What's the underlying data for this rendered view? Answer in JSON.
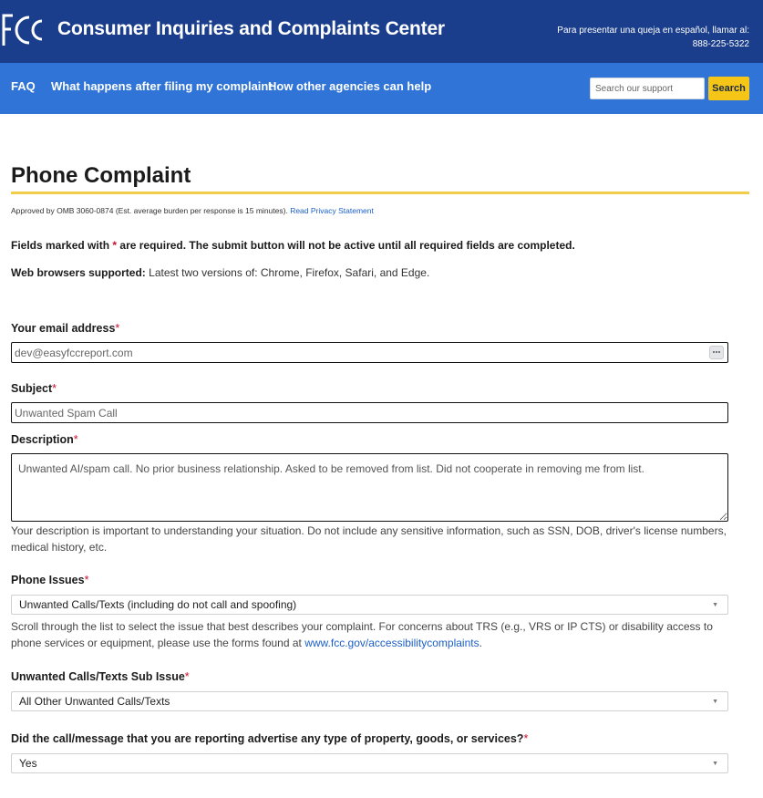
{
  "header": {
    "logo_text": "FCC",
    "title": "Consumer Inquiries and Complaints Center",
    "spanish_line1": "Para presentar una queja en español, llamar al:",
    "spanish_phone": "888-225-5322"
  },
  "nav": {
    "items": [
      {
        "label": "FAQ"
      },
      {
        "label": "What happens after filing my complaint"
      },
      {
        "label": "How other agencies can help"
      }
    ],
    "search_placeholder": "Search our support",
    "search_button": "Search"
  },
  "page": {
    "title": "Phone Complaint",
    "omb_text": "Approved by OMB 3060-0874 (Est. average burden per response is 15 minutes).",
    "privacy_link": "Read Privacy Statement",
    "required_note_before": "Fields marked with",
    "required_star": "*",
    "required_note_after": "are required. The submit button will not be active until all required fields are completed.",
    "browsers_label": "Web browsers supported:",
    "browsers_text": "Latest two versions of: Chrome, Firefox, Safari, and Edge."
  },
  "form": {
    "email": {
      "label": "Your email address",
      "placeholder": "dev@easyfccreport.com"
    },
    "subject": {
      "label": "Subject",
      "placeholder": "Unwanted Spam Call"
    },
    "description": {
      "label": "Description",
      "value": "Unwanted AI/spam call. No prior business relationship. Asked to be removed from list. Did not cooperate in removing me from list.",
      "help": "Your description is important to understanding your situation. Do not include any sensitive information, such as SSN, DOB, driver's license numbers, medical history, etc."
    },
    "phone_issues": {
      "label": "Phone Issues",
      "selected": "Unwanted Calls/Texts (including do not call and spoofing)",
      "help_before": "Scroll through the list to select the issue that best describes your complaint. For concerns about TRS (e.g., VRS or IP CTS) or disability access to phone services or equipment, please use the forms found at",
      "help_link": "www.fcc.gov/accessibilitycomplaints",
      "help_after": "."
    },
    "sub_issue": {
      "label": "Unwanted Calls/Texts Sub Issue",
      "selected": "All Other Unwanted Calls/Texts"
    },
    "advertise": {
      "label": "Did the call/message that you are reporting advertise any type of property, goods, or services?",
      "selected": "Yes"
    }
  },
  "colors": {
    "header_bg": "#1a3e8c",
    "nav_bg": "#2f74d6",
    "accent_yellow": "#f5c518",
    "required_red": "#c8102e",
    "link_blue": "#1b5fc7"
  }
}
